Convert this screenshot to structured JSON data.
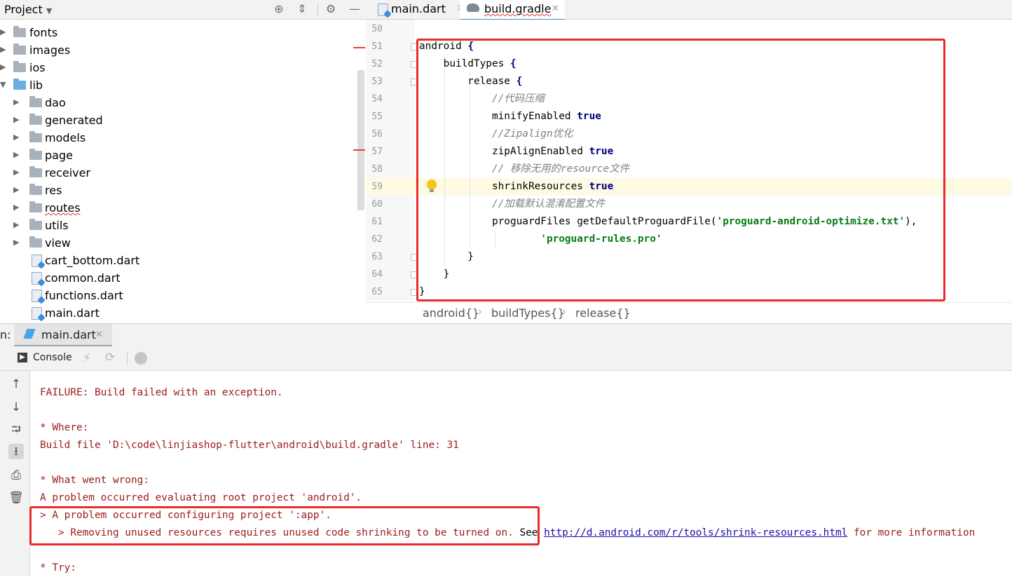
{
  "project_panel": {
    "title": "Project",
    "tree": [
      {
        "label": "fonts",
        "type": "folder"
      },
      {
        "label": "images",
        "type": "folder"
      },
      {
        "label": "ios",
        "type": "folder"
      },
      {
        "label": "lib",
        "type": "folder-open"
      },
      {
        "label": "dao",
        "type": "folder"
      },
      {
        "label": "generated",
        "type": "folder"
      },
      {
        "label": "models",
        "type": "folder"
      },
      {
        "label": "page",
        "type": "folder"
      },
      {
        "label": "receiver",
        "type": "folder"
      },
      {
        "label": "res",
        "type": "folder"
      },
      {
        "label": "routes",
        "type": "folder"
      },
      {
        "label": "utils",
        "type": "folder"
      },
      {
        "label": "view",
        "type": "folder"
      },
      {
        "label": "cart_bottom.dart",
        "type": "dart-file"
      },
      {
        "label": "common.dart",
        "type": "dart-file"
      },
      {
        "label": "functions.dart",
        "type": "dart-file"
      },
      {
        "label": "main.dart",
        "type": "dart-file"
      }
    ]
  },
  "editor": {
    "tabs": [
      {
        "label": "main.dart",
        "active": false
      },
      {
        "label": "build.gradle",
        "active": true
      }
    ],
    "line_numbers": [
      "50",
      "51",
      "52",
      "53",
      "54",
      "55",
      "56",
      "57",
      "58",
      "59",
      "60",
      "61",
      "62",
      "63",
      "64",
      "65"
    ],
    "code": {
      "l51_a": "android",
      "l51_b": " {",
      "l52_a": "    buildTypes",
      "l52_b": " {",
      "l53_a": "        release",
      "l53_b": " {",
      "l54": "            //代码压缩",
      "l55_a": "            minifyEnabled ",
      "l55_b": "true",
      "l56": "            //Zipalign优化",
      "l57_a": "            zipAlignEnabled ",
      "l57_b": "true",
      "l58": "            // 移除无用的resource文件",
      "l59_a": "            shrinkResources ",
      "l59_b": "true",
      "l60": "            //加载默认混淆配置文件",
      "l61_a": "            proguardFiles getDefaultProguardFile(",
      "l61_b": "'proguard-android-optimize.txt'",
      "l61_c": "),",
      "l62_a": "                    ",
      "l62_b": "'proguard-rules.pro'",
      "l63": "        }",
      "l64": "    }",
      "l65": "}"
    },
    "breadcrumb": [
      "android{}",
      "buildTypes{}",
      "release{}"
    ]
  },
  "run_panel": {
    "label": "n:",
    "tab": "main.dart",
    "console_label": "Console",
    "output": {
      "o1": "FAILURE: Build failed with an exception.",
      "o2": "* Where:",
      "o3": "Build file 'D:\\code\\linjiashop-flutter\\android\\build.gradle' line: 31",
      "o4": "* What went wrong:",
      "o5": "A problem occurred evaluating root project 'android'.",
      "o6": "> A problem occurred configuring project ':app'.",
      "o7": "   > Removing unused resources requires unused code shrinking to be turned on.",
      "o7_see": " See ",
      "o7_link": "http://d.android.com/r/tools/shrink-resources.html",
      "o7_tail": " for more information",
      "o8": "* Try:"
    }
  },
  "colors": {
    "highlight_box": "#e82c2c",
    "keyword": "#000080",
    "string": "#067d17",
    "comment": "#808080",
    "error_text": "#9c1b1b"
  }
}
